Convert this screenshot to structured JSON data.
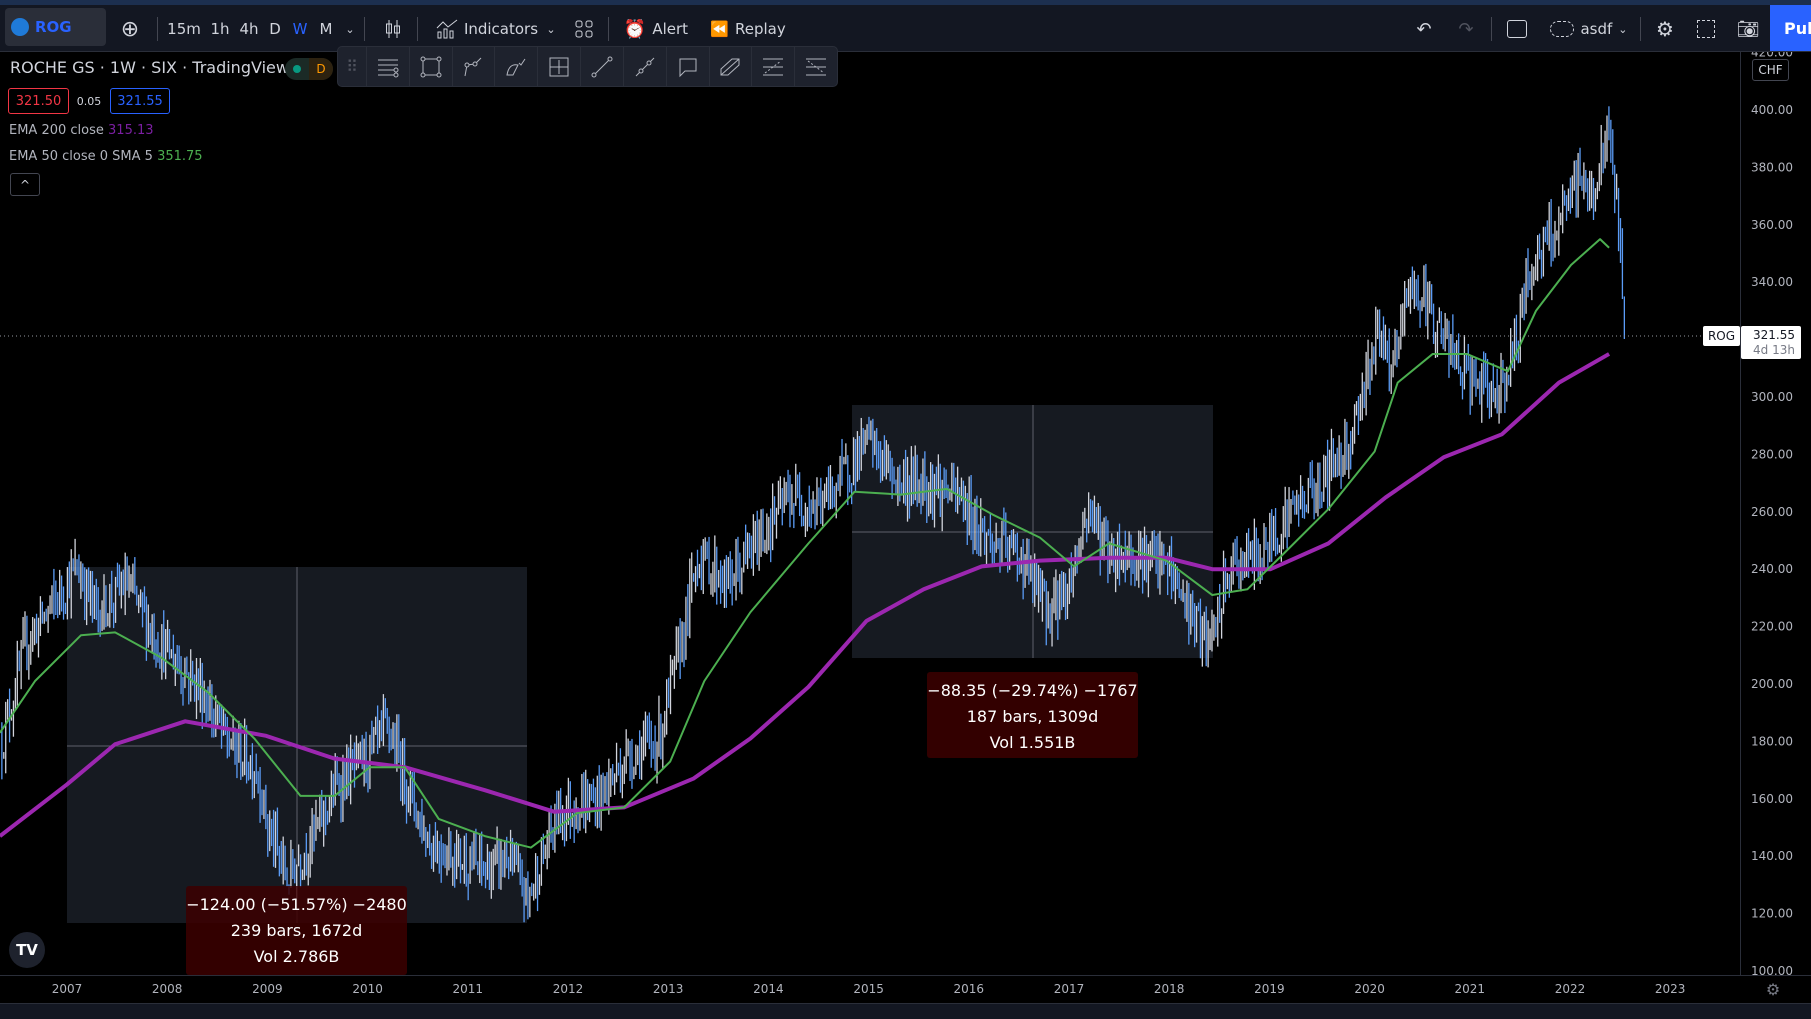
{
  "topbar": {
    "symbol": "ROG",
    "intervals": [
      "15m",
      "1h",
      "4h",
      "D",
      "W",
      "M"
    ],
    "active_interval": "W",
    "indicators_label": "Indicators",
    "alert_label": "Alert",
    "replay_label": "Replay",
    "layout_name": "asdf",
    "publish_label": "Pub"
  },
  "legend": {
    "title": "ROCHE GS · 1W · SIX · TradingView",
    "market_status": "D",
    "bid": "321.50",
    "spread": "0.05",
    "ask": "321.55",
    "ema200_label": "EMA 200 close",
    "ema200_value": "315.13",
    "ema50_label": "EMA 50 close 0 SMA 5",
    "ema50_value": "351.75"
  },
  "price_axis": {
    "currency": "CHF",
    "ticks": [
      "420.00",
      "400.00",
      "380.00",
      "360.00",
      "340.00",
      "320.00",
      "300.00",
      "280.00",
      "260.00",
      "240.00",
      "220.00",
      "200.00",
      "180.00",
      "160.00",
      "140.00",
      "120.00",
      "100.00"
    ],
    "last_symbol": "ROG",
    "last_price": "321.55",
    "countdown": "4d 13h"
  },
  "time_axis": [
    "2007",
    "2008",
    "2009",
    "2010",
    "2011",
    "2012",
    "2013",
    "2014",
    "2015",
    "2016",
    "2017",
    "2018",
    "2019",
    "2020",
    "2021",
    "2022",
    "2023"
  ],
  "measurements": [
    {
      "line1": "−124.00 (−51.57%) −2480",
      "line2": "239 bars, 1672d",
      "line3": "Vol 2.786B"
    },
    {
      "line1": "−88.35 (−29.74%) −1767",
      "line2": "187 bars, 1309d",
      "line3": "Vol 1.551B"
    }
  ],
  "colors": {
    "up": "#d1d4dc",
    "down": "#5b9cf6",
    "ema50": "#4caf50",
    "ema200": "#9c27b0",
    "accent": "#2962ff"
  },
  "chart_data": {
    "type": "line",
    "title": "ROCHE GS · 1W · SIX",
    "ylim": [
      100,
      420
    ],
    "xlim": [
      2006.33,
      2023.7
    ],
    "price_anchors": [
      [
        2006.35,
        180
      ],
      [
        2006.6,
        215
      ],
      [
        2006.9,
        230
      ],
      [
        2007.1,
        240
      ],
      [
        2007.3,
        225
      ],
      [
        2007.6,
        235
      ],
      [
        2007.9,
        215
      ],
      [
        2008.3,
        200
      ],
      [
        2008.6,
        180
      ],
      [
        2008.9,
        170
      ],
      [
        2009.0,
        150
      ],
      [
        2009.2,
        132
      ],
      [
        2009.5,
        150
      ],
      [
        2009.7,
        165
      ],
      [
        2010.0,
        175
      ],
      [
        2010.2,
        185
      ],
      [
        2010.4,
        165
      ],
      [
        2010.6,
        145
      ],
      [
        2010.9,
        140
      ],
      [
        2011.2,
        135
      ],
      [
        2011.4,
        140
      ],
      [
        2011.6,
        125
      ],
      [
        2011.9,
        155
      ],
      [
        2012.3,
        160
      ],
      [
        2012.6,
        175
      ],
      [
        2012.9,
        180
      ],
      [
        2013.1,
        210
      ],
      [
        2013.3,
        245
      ],
      [
        2013.6,
        235
      ],
      [
        2013.9,
        250
      ],
      [
        2014.2,
        265
      ],
      [
        2014.5,
        262
      ],
      [
        2014.8,
        275
      ],
      [
        2015.0,
        285
      ],
      [
        2015.3,
        270
      ],
      [
        2015.6,
        270
      ],
      [
        2015.9,
        265
      ],
      [
        2016.2,
        250
      ],
      [
        2016.5,
        245
      ],
      [
        2016.8,
        225
      ],
      [
        2017.0,
        235
      ],
      [
        2017.2,
        262
      ],
      [
        2017.4,
        245
      ],
      [
        2017.7,
        245
      ],
      [
        2018.0,
        240
      ],
      [
        2018.2,
        225
      ],
      [
        2018.4,
        212
      ],
      [
        2018.6,
        240
      ],
      [
        2018.9,
        245
      ],
      [
        2019.2,
        260
      ],
      [
        2019.5,
        270
      ],
      [
        2019.8,
        285
      ],
      [
        2020.1,
        325
      ],
      [
        2020.2,
        305
      ],
      [
        2020.4,
        340
      ],
      [
        2020.6,
        330
      ],
      [
        2020.9,
        310
      ],
      [
        2021.2,
        300
      ],
      [
        2021.4,
        310
      ],
      [
        2021.6,
        345
      ],
      [
        2021.9,
        360
      ],
      [
        2022.1,
        378
      ],
      [
        2022.2,
        368
      ],
      [
        2022.4,
        392
      ],
      [
        2022.5,
        352
      ],
      [
        2022.56,
        321.55
      ]
    ],
    "ema200": [
      [
        2006.33,
        147
      ],
      [
        2007.0,
        165
      ],
      [
        2007.48,
        179
      ],
      [
        2008.18,
        187
      ],
      [
        2008.98,
        182
      ],
      [
        2009.67,
        174
      ],
      [
        2010.37,
        171
      ],
      [
        2011.17,
        163
      ],
      [
        2011.86,
        155.5
      ],
      [
        2012.56,
        157
      ],
      [
        2013.25,
        167
      ],
      [
        2013.82,
        181
      ],
      [
        2014.4,
        199
      ],
      [
        2014.98,
        222
      ],
      [
        2015.55,
        233
      ],
      [
        2016.13,
        241
      ],
      [
        2016.71,
        243
      ],
      [
        2017.4,
        244
      ],
      [
        2017.97,
        244
      ],
      [
        2018.43,
        240
      ],
      [
        2019.01,
        240
      ],
      [
        2019.59,
        249
      ],
      [
        2020.16,
        265
      ],
      [
        2020.74,
        279
      ],
      [
        2021.32,
        287
      ],
      [
        2021.89,
        305
      ],
      [
        2022.39,
        315
      ]
    ],
    "ema50": [
      [
        2006.33,
        183
      ],
      [
        2006.68,
        201
      ],
      [
        2007.14,
        217
      ],
      [
        2007.48,
        218
      ],
      [
        2007.95,
        209
      ],
      [
        2008.41,
        197
      ],
      [
        2008.87,
        181
      ],
      [
        2009.33,
        161
      ],
      [
        2009.67,
        161
      ],
      [
        2010.02,
        171
      ],
      [
        2010.37,
        171
      ],
      [
        2010.71,
        153
      ],
      [
        2011.17,
        147
      ],
      [
        2011.63,
        143
      ],
      [
        2012.09,
        155
      ],
      [
        2012.56,
        157
      ],
      [
        2013.02,
        173
      ],
      [
        2013.36,
        201
      ],
      [
        2013.82,
        225
      ],
      [
        2014.4,
        249
      ],
      [
        2014.86,
        267
      ],
      [
        2015.32,
        266
      ],
      [
        2015.78,
        268
      ],
      [
        2016.24,
        259
      ],
      [
        2016.71,
        251
      ],
      [
        2017.05,
        241
      ],
      [
        2017.4,
        249
      ],
      [
        2017.97,
        243
      ],
      [
        2018.43,
        231
      ],
      [
        2018.78,
        233
      ],
      [
        2019.13,
        245
      ],
      [
        2019.59,
        261
      ],
      [
        2020.05,
        281
      ],
      [
        2020.28,
        305
      ],
      [
        2020.63,
        315
      ],
      [
        2020.97,
        315
      ],
      [
        2021.38,
        309
      ],
      [
        2021.66,
        330
      ],
      [
        2022.01,
        346
      ],
      [
        2022.3,
        355
      ],
      [
        2022.39,
        352
      ]
    ],
    "series": [
      {
        "name": "ROG weekly"
      },
      {
        "name": "EMA 200"
      },
      {
        "name": "EMA 50"
      }
    ]
  }
}
